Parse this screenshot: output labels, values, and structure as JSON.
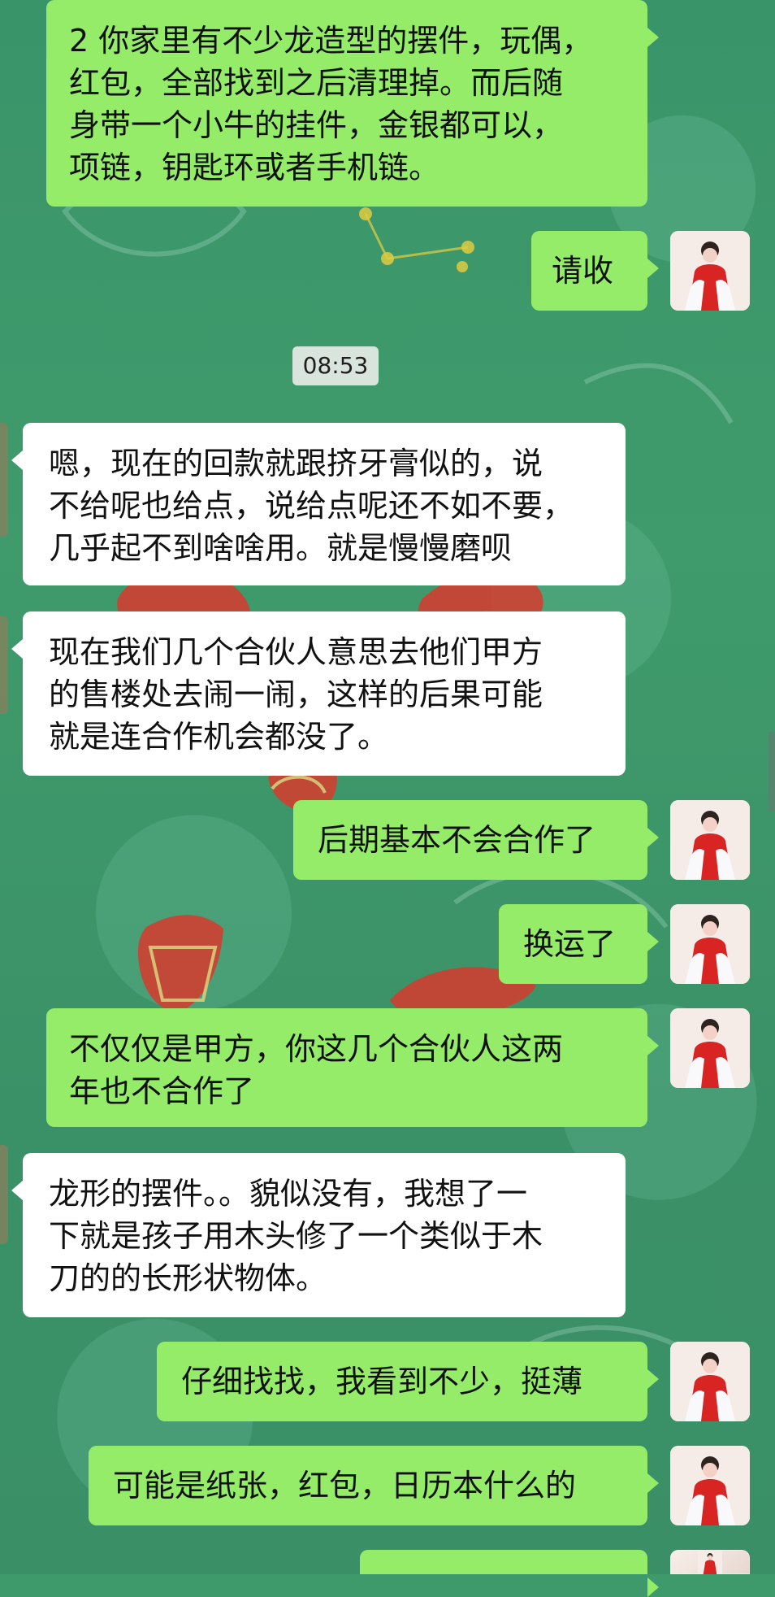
{
  "chat": {
    "timestamp": "08:53",
    "messages": [
      {
        "id": "m1",
        "sender": "contact",
        "side": "right",
        "text": "2 你家里有不少龙造型的摆件，玩偶，\n红包，全部找到之后清理掉。而后随\n身带一个小牛的挂件，金银都可以，\n项链，钥匙环或者手机链。"
      },
      {
        "id": "m2",
        "sender": "contact",
        "side": "right",
        "text": "请收"
      },
      {
        "id": "m3",
        "sender": "user",
        "side": "left",
        "text": "嗯，现在的回款就跟挤牙膏似的，说\n不给呢也给点，说给点呢还不如不要，\n几乎起不到啥啥用。就是慢慢磨呗"
      },
      {
        "id": "m4",
        "sender": "user",
        "side": "left",
        "text": "现在我们几个合伙人意思去他们甲方\n的售楼处去闹一闹，这样的后果可能\n就是连合作机会都没了。"
      },
      {
        "id": "m5",
        "sender": "contact",
        "side": "right",
        "text": "后期基本不会合作了"
      },
      {
        "id": "m6",
        "sender": "contact",
        "side": "right",
        "text": "换运了"
      },
      {
        "id": "m7",
        "sender": "contact",
        "side": "right",
        "text": "不仅仅是甲方，你这几个合伙人这两\n年也不合作了"
      },
      {
        "id": "m8",
        "sender": "user",
        "side": "left",
        "text": "龙形的摆件。。貌似没有，我想了一\n下就是孩子用木头修了一个类似于木\n刀的的长形状物体。"
      },
      {
        "id": "m9",
        "sender": "contact",
        "side": "right",
        "text": "仔细找找，我看到不少，挺薄"
      },
      {
        "id": "m10",
        "sender": "contact",
        "side": "right",
        "text": "可能是纸张，红包，日历本什么的"
      }
    ]
  },
  "colors": {
    "background": "#3f9a6b",
    "sent_bubble": "#95ec69",
    "received_bubble": "#ffffff",
    "timestamp_chip": "#d9e4dc"
  },
  "icons": {
    "contact_avatar": "avatar-icon",
    "user_avatar_edge": "avatar-edge-icon"
  }
}
